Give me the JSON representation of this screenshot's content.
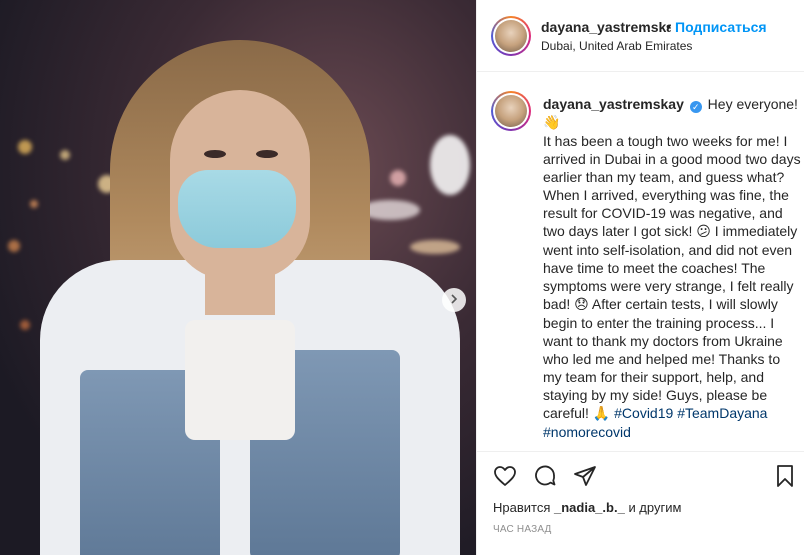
{
  "post": {
    "username": "dayana_yastremskay",
    "dot": "•",
    "follow_label": "Подписаться",
    "location": "Dubai, United Arab Emirates"
  },
  "caption": {
    "author": "dayana_yastremskay",
    "line1": "Hey everyone!",
    "emoji_wave": "👋",
    "body1": "It has been a tough two weeks for me! I arrived in Dubai in a good mood two days earlier than my team, and guess what? When I arrived, everything was fine, the result for COVID-19 was negative, and two days later I got sick!",
    "emoji_confused": "😕",
    "body2": "I immediately went into self-isolation, and did not even have time to meet the coaches! The symptoms were very strange, I felt really bad!",
    "emoji_sad": "😞",
    "body3": "After certain tests, I will slowly begin to enter the training process... I want to thank my doctors from Ukraine who led me and helped me! Thanks to my team for their support, help, and staying by my side! Guys, please be careful!",
    "emoji_pray": "🙏",
    "tags": [
      "#Covid19",
      "#TeamDayana",
      "#nomorecovid"
    ]
  },
  "likes": {
    "prefix": "Нравится",
    "user": "_nadia_.b._",
    "suffix": "и другим"
  },
  "timestamp": "ЧАС НАЗАД",
  "icons": {
    "like": "heart-icon",
    "comment": "comment-icon",
    "share": "share-icon",
    "save": "bookmark-icon",
    "next": "chevron-right-icon",
    "verified": "verified-badge-icon"
  },
  "colors": {
    "link": "#0095f6",
    "hashtag": "#00376b",
    "verified": "#3897f0",
    "muted": "#8e8e8e"
  }
}
